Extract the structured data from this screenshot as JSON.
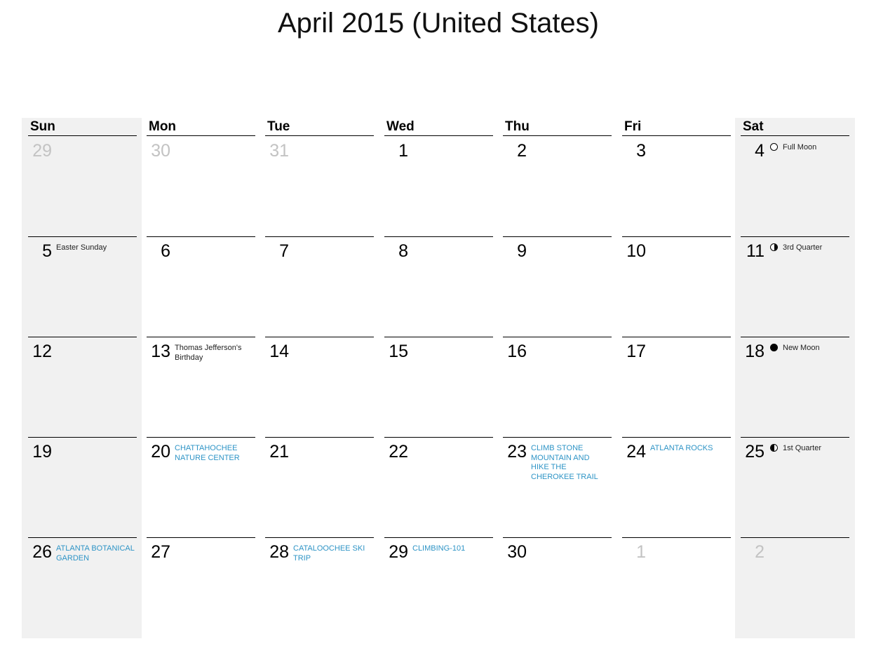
{
  "title": "April 2015 (United States)",
  "weekdays": [
    "Sun",
    "Mon",
    "Tue",
    "Wed",
    "Thu",
    "Fri",
    "Sat"
  ],
  "colors": {
    "event": "#2e94c6",
    "weekend_bg": "#f1f1f1",
    "muted_day": "#c3c3c3"
  },
  "weeks": [
    [
      {
        "day": "29",
        "muted": true
      },
      {
        "day": "30",
        "muted": true
      },
      {
        "day": "31",
        "muted": true
      },
      {
        "day": "1"
      },
      {
        "day": "2"
      },
      {
        "day": "3"
      },
      {
        "day": "4",
        "moon": "full",
        "moon_label": "Full Moon"
      }
    ],
    [
      {
        "day": "5",
        "holiday": "Easter Sunday"
      },
      {
        "day": "6"
      },
      {
        "day": "7"
      },
      {
        "day": "8"
      },
      {
        "day": "9"
      },
      {
        "day": "10"
      },
      {
        "day": "11",
        "moon": "third",
        "moon_label": "3rd Quarter"
      }
    ],
    [
      {
        "day": "12"
      },
      {
        "day": "13",
        "holiday": "Thomas Jefferson's Birthday"
      },
      {
        "day": "14"
      },
      {
        "day": "15"
      },
      {
        "day": "16"
      },
      {
        "day": "17"
      },
      {
        "day": "18",
        "moon": "new",
        "moon_label": "New Moon"
      }
    ],
    [
      {
        "day": "19"
      },
      {
        "day": "20",
        "event": "CHATTAHOCHEE NATURE CENTER"
      },
      {
        "day": "21"
      },
      {
        "day": "22"
      },
      {
        "day": "23",
        "event": "CLIMB STONE MOUNTAIN AND HIKE THE CHEROKEE TRAIL"
      },
      {
        "day": "24",
        "event": "ATLANTA ROCKS"
      },
      {
        "day": "25",
        "moon": "first",
        "moon_label": "1st Quarter"
      }
    ],
    [
      {
        "day": "26",
        "event": "ATLANTA BOTANICAL GARDEN"
      },
      {
        "day": "27"
      },
      {
        "day": "28",
        "event": "CATALOOCHEE SKI TRIP"
      },
      {
        "day": "29",
        "event": "CLIMBING-101"
      },
      {
        "day": "30"
      },
      {
        "day": "1",
        "muted": true
      },
      {
        "day": "2",
        "muted": true
      }
    ]
  ]
}
